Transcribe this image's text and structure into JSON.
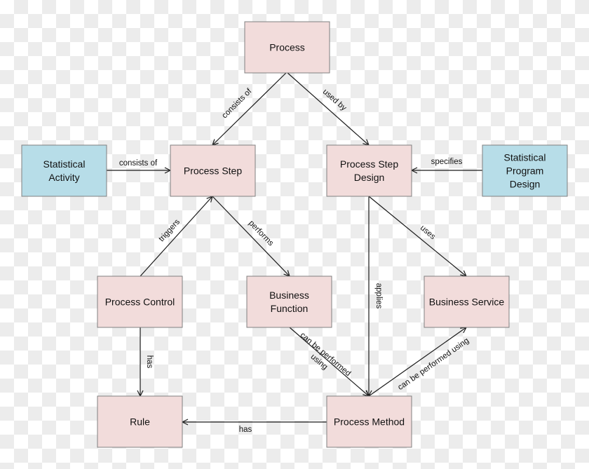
{
  "colors": {
    "process_box": "#f2dcdb",
    "external_box": "#b7dde8",
    "border": "#808080",
    "line": "#1a1a1a"
  },
  "nodes": {
    "process": {
      "label": [
        "Process"
      ],
      "kind": "process"
    },
    "statistical_activity": {
      "label": [
        "Statistical",
        "Activity"
      ],
      "kind": "external"
    },
    "process_step": {
      "label": [
        "Process Step"
      ],
      "kind": "process"
    },
    "process_step_design": {
      "label": [
        "Process Step",
        "Design"
      ],
      "kind": "process"
    },
    "statistical_program_design": {
      "label": [
        "Statistical",
        "Program",
        "Design"
      ],
      "kind": "external"
    },
    "process_control": {
      "label": [
        "Process Control"
      ],
      "kind": "process"
    },
    "business_function": {
      "label": [
        "Business",
        "Function"
      ],
      "kind": "process"
    },
    "business_service": {
      "label": [
        "Business Service"
      ],
      "kind": "process"
    },
    "rule": {
      "label": [
        "Rule"
      ],
      "kind": "process"
    },
    "process_method": {
      "label": [
        "Process Method"
      ],
      "kind": "process"
    }
  },
  "edges": [
    {
      "from": "process",
      "to": "process_step",
      "label": [
        "consists of"
      ]
    },
    {
      "from": "process",
      "to": "process_step_design",
      "label": [
        "used by"
      ]
    },
    {
      "from": "statistical_activity",
      "to": "process_step",
      "label": [
        "consists of"
      ]
    },
    {
      "from": "statistical_program_design",
      "to": "process_step_design",
      "label": [
        "specifies"
      ]
    },
    {
      "from": "process_control",
      "to": "process_step",
      "label": [
        "triggers"
      ]
    },
    {
      "from": "process_step",
      "to": "business_function",
      "label": [
        "performs"
      ]
    },
    {
      "from": "process_step_design",
      "to": "process_method",
      "label": [
        "applies"
      ]
    },
    {
      "from": "process_step_design",
      "to": "business_service",
      "label": [
        "uses"
      ]
    },
    {
      "from": "process_control",
      "to": "rule",
      "label": [
        "has"
      ]
    },
    {
      "from": "business_function",
      "to": "process_method",
      "label": [
        "can be performed",
        "using"
      ]
    },
    {
      "from": "process_method",
      "to": "business_service",
      "label": [
        "can be performed using"
      ]
    },
    {
      "from": "process_method",
      "to": "rule",
      "label": [
        "has"
      ]
    }
  ]
}
